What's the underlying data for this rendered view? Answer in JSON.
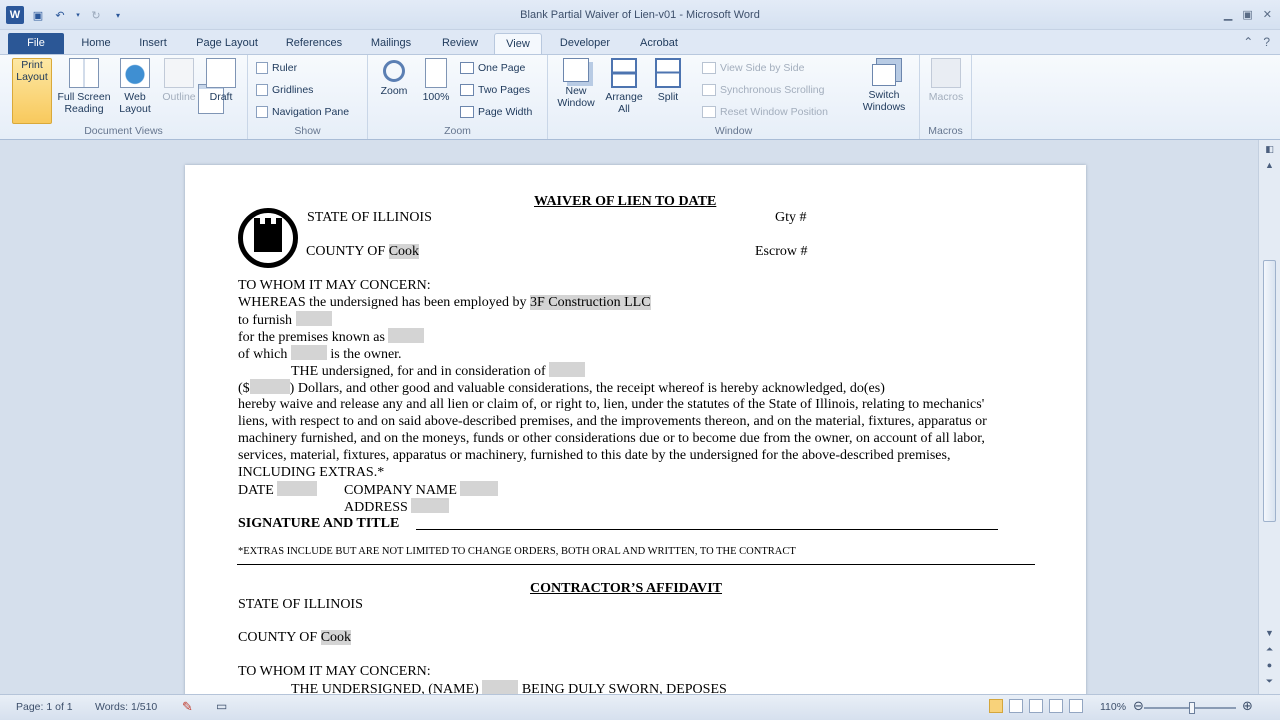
{
  "window": {
    "title": "Blank Partial Waiver of Lien-v01  -  Microsoft Word",
    "app_icon": "W"
  },
  "tabs": [
    "File",
    "Home",
    "Insert",
    "Page Layout",
    "References",
    "Mailings",
    "Review",
    "View",
    "Developer",
    "Acrobat"
  ],
  "ribbon": {
    "document_views": {
      "label": "Document Views",
      "print_layout": "Print Layout",
      "full_screen": "Full Screen Reading",
      "web_layout": "Web Layout",
      "outline": "Outline",
      "draft": "Draft"
    },
    "show": {
      "label": "Show",
      "ruler": "Ruler",
      "gridlines": "Gridlines",
      "nav_pane": "Navigation Pane"
    },
    "zoom": {
      "label": "Zoom",
      "zoom": "Zoom",
      "hundred": "100%",
      "one_page": "One Page",
      "two_pages": "Two Pages",
      "page_width": "Page Width"
    },
    "window": {
      "label": "Window",
      "new_window": "New Window",
      "arrange_all": "Arrange All",
      "split": "Split",
      "side_by_side": "View Side by Side",
      "sync_scroll": "Synchronous Scrolling",
      "reset_pos": "Reset Window Position",
      "switch_windows": "Switch Windows"
    },
    "macros": {
      "label": "Macros",
      "macros": "Macros"
    }
  },
  "document": {
    "heading1": "WAIVER OF LIEN TO DATE",
    "state": "STATE OF ILLINOIS",
    "gty": "Gty #",
    "county_prefix": "COUNTY OF ",
    "county_value": "Cook",
    "escrow": "Escrow #",
    "to_whom": "TO WHOM IT MAY CONCERN:",
    "whereas": "WHEREAS the undersigned has been employed by ",
    "company": "3F Construction LLC",
    "to_furnish": "to furnish",
    "premises": "for the premises known as",
    "of_which": "of which",
    "is_owner": "is the owner.",
    "undersigned_consideration": "THE undersigned, for and in consideration of",
    "dollars_open": "($",
    "dollars_rest": ") Dollars, and other good and valuable considerations, the receipt whereof is hereby acknowledged, do(es)",
    "para1": "hereby waive and release any and all lien or claim of, or right to, lien, under the statutes of the State of Illinois, relating to mechanics'",
    "para2": "liens, with respect to and on said above-described premises, and the improvements thereon, and on the material, fixtures, apparatus or",
    "para3": "machinery furnished, and on the moneys, funds or other considerations due or to become due from the owner, on account of all labor,",
    "para4": "services, material, fixtures, apparatus or machinery, furnished to this date by the undersigned for the above-described premises,",
    "para5": "INCLUDING EXTRAS.*",
    "date_label": "DATE",
    "company_name_label": "COMPANY NAME",
    "address_label": "ADDRESS",
    "signature_label": "SIGNATURE AND TITLE",
    "footnote": "*EXTRAS INCLUDE BUT ARE NOT LIMITED TO CHANGE ORDERS, BOTH ORAL AND WRITTEN, TO THE CONTRACT",
    "heading2": "CONTRACTOR’S AFFIDAVIT",
    "state2": "STATE OF ILLINOIS",
    "county2_value": "Cook",
    "to_whom2": "TO WHOM IT MAY CONCERN:",
    "undersigned_name": "THE UNDERSIGNED, (NAME)",
    "being_sworn": "BEING DULY SWORN, DEPOSES"
  },
  "status": {
    "page": "Page: 1 of 1",
    "words": "Words: 1/510",
    "zoom": "110%"
  }
}
